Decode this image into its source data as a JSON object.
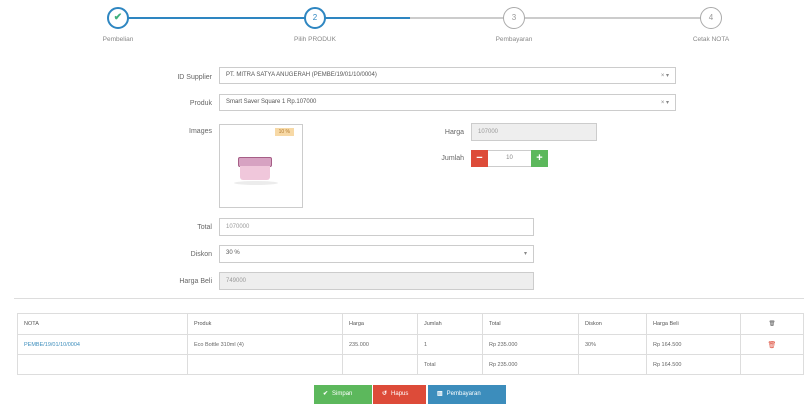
{
  "wizard": {
    "steps": [
      {
        "num": "✔",
        "label": "Pembelian",
        "status": "done"
      },
      {
        "num": "2",
        "label": "Pilih PRODUK",
        "status": "active"
      },
      {
        "num": "3",
        "label": "Pembayaran",
        "status": "todo"
      },
      {
        "num": "4",
        "label": "Cetak NOTA",
        "status": "todo"
      }
    ]
  },
  "form": {
    "supplier_label": "ID Supplier",
    "supplier_value": "PT. MITRA SATYA ANUGERAH (PEMBE/19/01/10/0004)",
    "produk_label": "Produk",
    "produk_value": "Smart Saver Square 1 Rp.107000",
    "select_controls": "× ▾",
    "images_label": "Images",
    "image_badge": "10 %",
    "harga_label": "Harga",
    "harga_value": "107000",
    "jumlah_label": "Jumlah",
    "jumlah_value": "10",
    "minus": "−",
    "plus": "+",
    "total_label": "Total",
    "total_value": "1070000",
    "diskon_label": "Diskon",
    "diskon_value": "30 %",
    "diskon_arrow": "▾",
    "hargabeli_label": "Harga Beli",
    "hargabeli_value": "749000"
  },
  "table": {
    "headers": [
      "NOTA",
      "Produk",
      "Harga",
      "Jumlah",
      "Total",
      "Diskon",
      "Harga Beli",
      "🗑"
    ],
    "rows": [
      [
        "PEMBE/19/01/10/0004",
        "Eco Bottle 310ml (4)",
        "235.000",
        "1",
        "Rp 235.000",
        "30%",
        "Rp 164.500",
        "🗑"
      ]
    ],
    "footer": {
      "label": "Total",
      "total": "Rp 235.000",
      "harga_beli": "Rp 164.500"
    }
  },
  "buttons": {
    "save": {
      "icon": "✔",
      "label": "Simpan"
    },
    "delete": {
      "icon": "↺",
      "label": "Hapus"
    },
    "pay": {
      "icon": "▥",
      "label": "Pembayaran"
    }
  },
  "colors": {
    "primary": "#2e86c1",
    "success": "#5cb85c",
    "danger": "#dd4b39",
    "info": "#3c8dbc"
  }
}
